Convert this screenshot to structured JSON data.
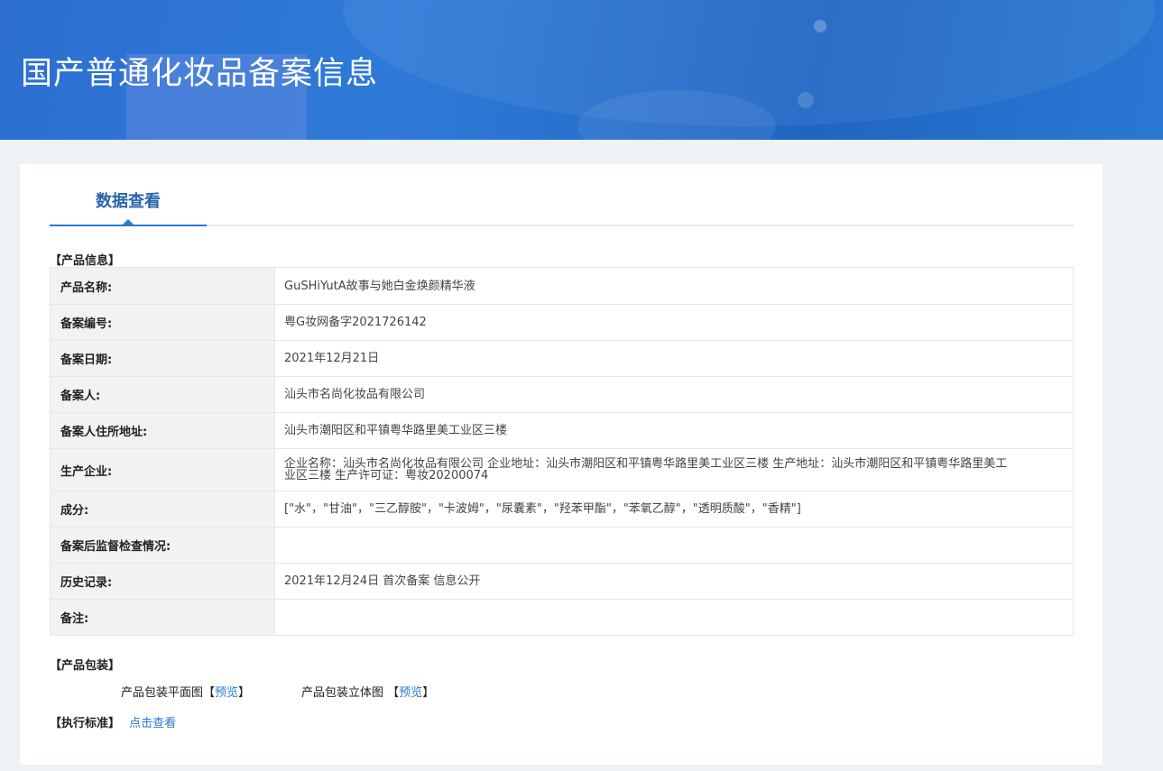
{
  "header": {
    "title": "国产普通化妆品备案信息"
  },
  "tabs": [
    {
      "label": "数据查看"
    }
  ],
  "product_info": {
    "section_label": "【产品信息】",
    "rows": [
      {
        "label": "产品名称:",
        "value": "GuSHiYutA故事与她白金焕颜精华液"
      },
      {
        "label": "备案编号:",
        "value": "粤G妆网备字2021726142"
      },
      {
        "label": "备案日期:",
        "value": "2021年12月21日"
      },
      {
        "label": "备案人:",
        "value": "汕头市名尚化妆品有限公司"
      },
      {
        "label": "备案人住所地址:",
        "value": "汕头市潮阳区和平镇粤华路里美工业区三楼"
      },
      {
        "label": "生产企业:",
        "value": "企业名称：汕头市名尚化妆品有限公司 企业地址：汕头市潮阳区和平镇粤华路里美工业区三楼 生产地址：汕头市潮阳区和平镇粤华路里美工业区三楼 生产许可证：粤妆20200074"
      },
      {
        "label": "成分:",
        "value": "[\"水\"，\"甘油\"，\"三乙醇胺\"，\"卡波姆\"，\"尿囊素\"，\"羟苯甲酯\"，\"苯氧乙醇\"，\"透明质酸\"，\"香精\"]"
      },
      {
        "label": "备案后监督检查情况:",
        "value": ""
      },
      {
        "label": "历史记录:",
        "value": "2021年12月24日 首次备案 信息公开"
      },
      {
        "label": "备注:",
        "value": ""
      }
    ]
  },
  "packaging": {
    "section_label": "【产品包装】",
    "flat_label": "产品包装平面图",
    "flat_preview_open": "【",
    "flat_preview": "预览",
    "flat_preview_close": "】",
    "solid_label": "产品包装立体图",
    "solid_preview_open": "【",
    "solid_preview": "预览",
    "solid_preview_close": "】"
  },
  "standard": {
    "section_label": "【执行标准】",
    "link_label": "点击查看"
  },
  "colors": {
    "banner": "#2c6fd0",
    "accent": "#2a7ad3",
    "tab_text": "#2a62a8",
    "label_bg": "#f2f2f2"
  }
}
